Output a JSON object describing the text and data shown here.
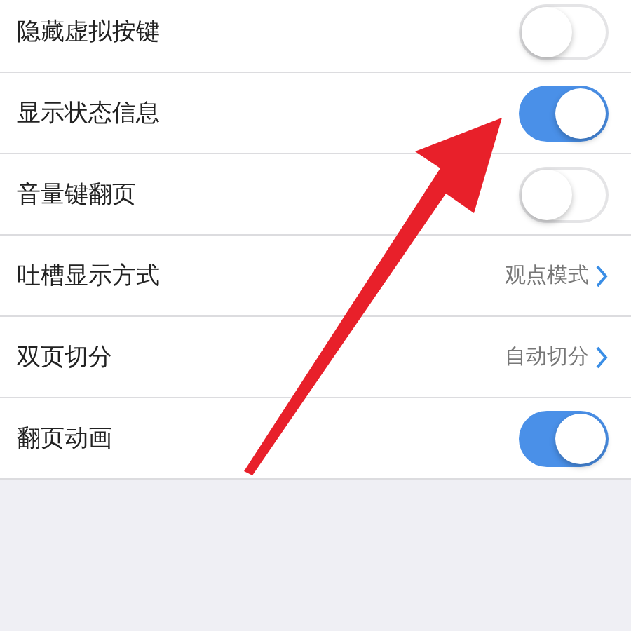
{
  "settings": [
    {
      "kind": "toggle",
      "label": "隐藏虚拟按键",
      "on": false
    },
    {
      "kind": "toggle",
      "label": "显示状态信息",
      "on": true
    },
    {
      "kind": "toggle",
      "label": "音量键翻页",
      "on": false
    },
    {
      "kind": "value",
      "label": "吐槽显示方式",
      "value": "观点模式"
    },
    {
      "kind": "value",
      "label": "双页切分",
      "value": "自动切分"
    },
    {
      "kind": "toggle",
      "label": "翻页动画",
      "on": true
    }
  ]
}
